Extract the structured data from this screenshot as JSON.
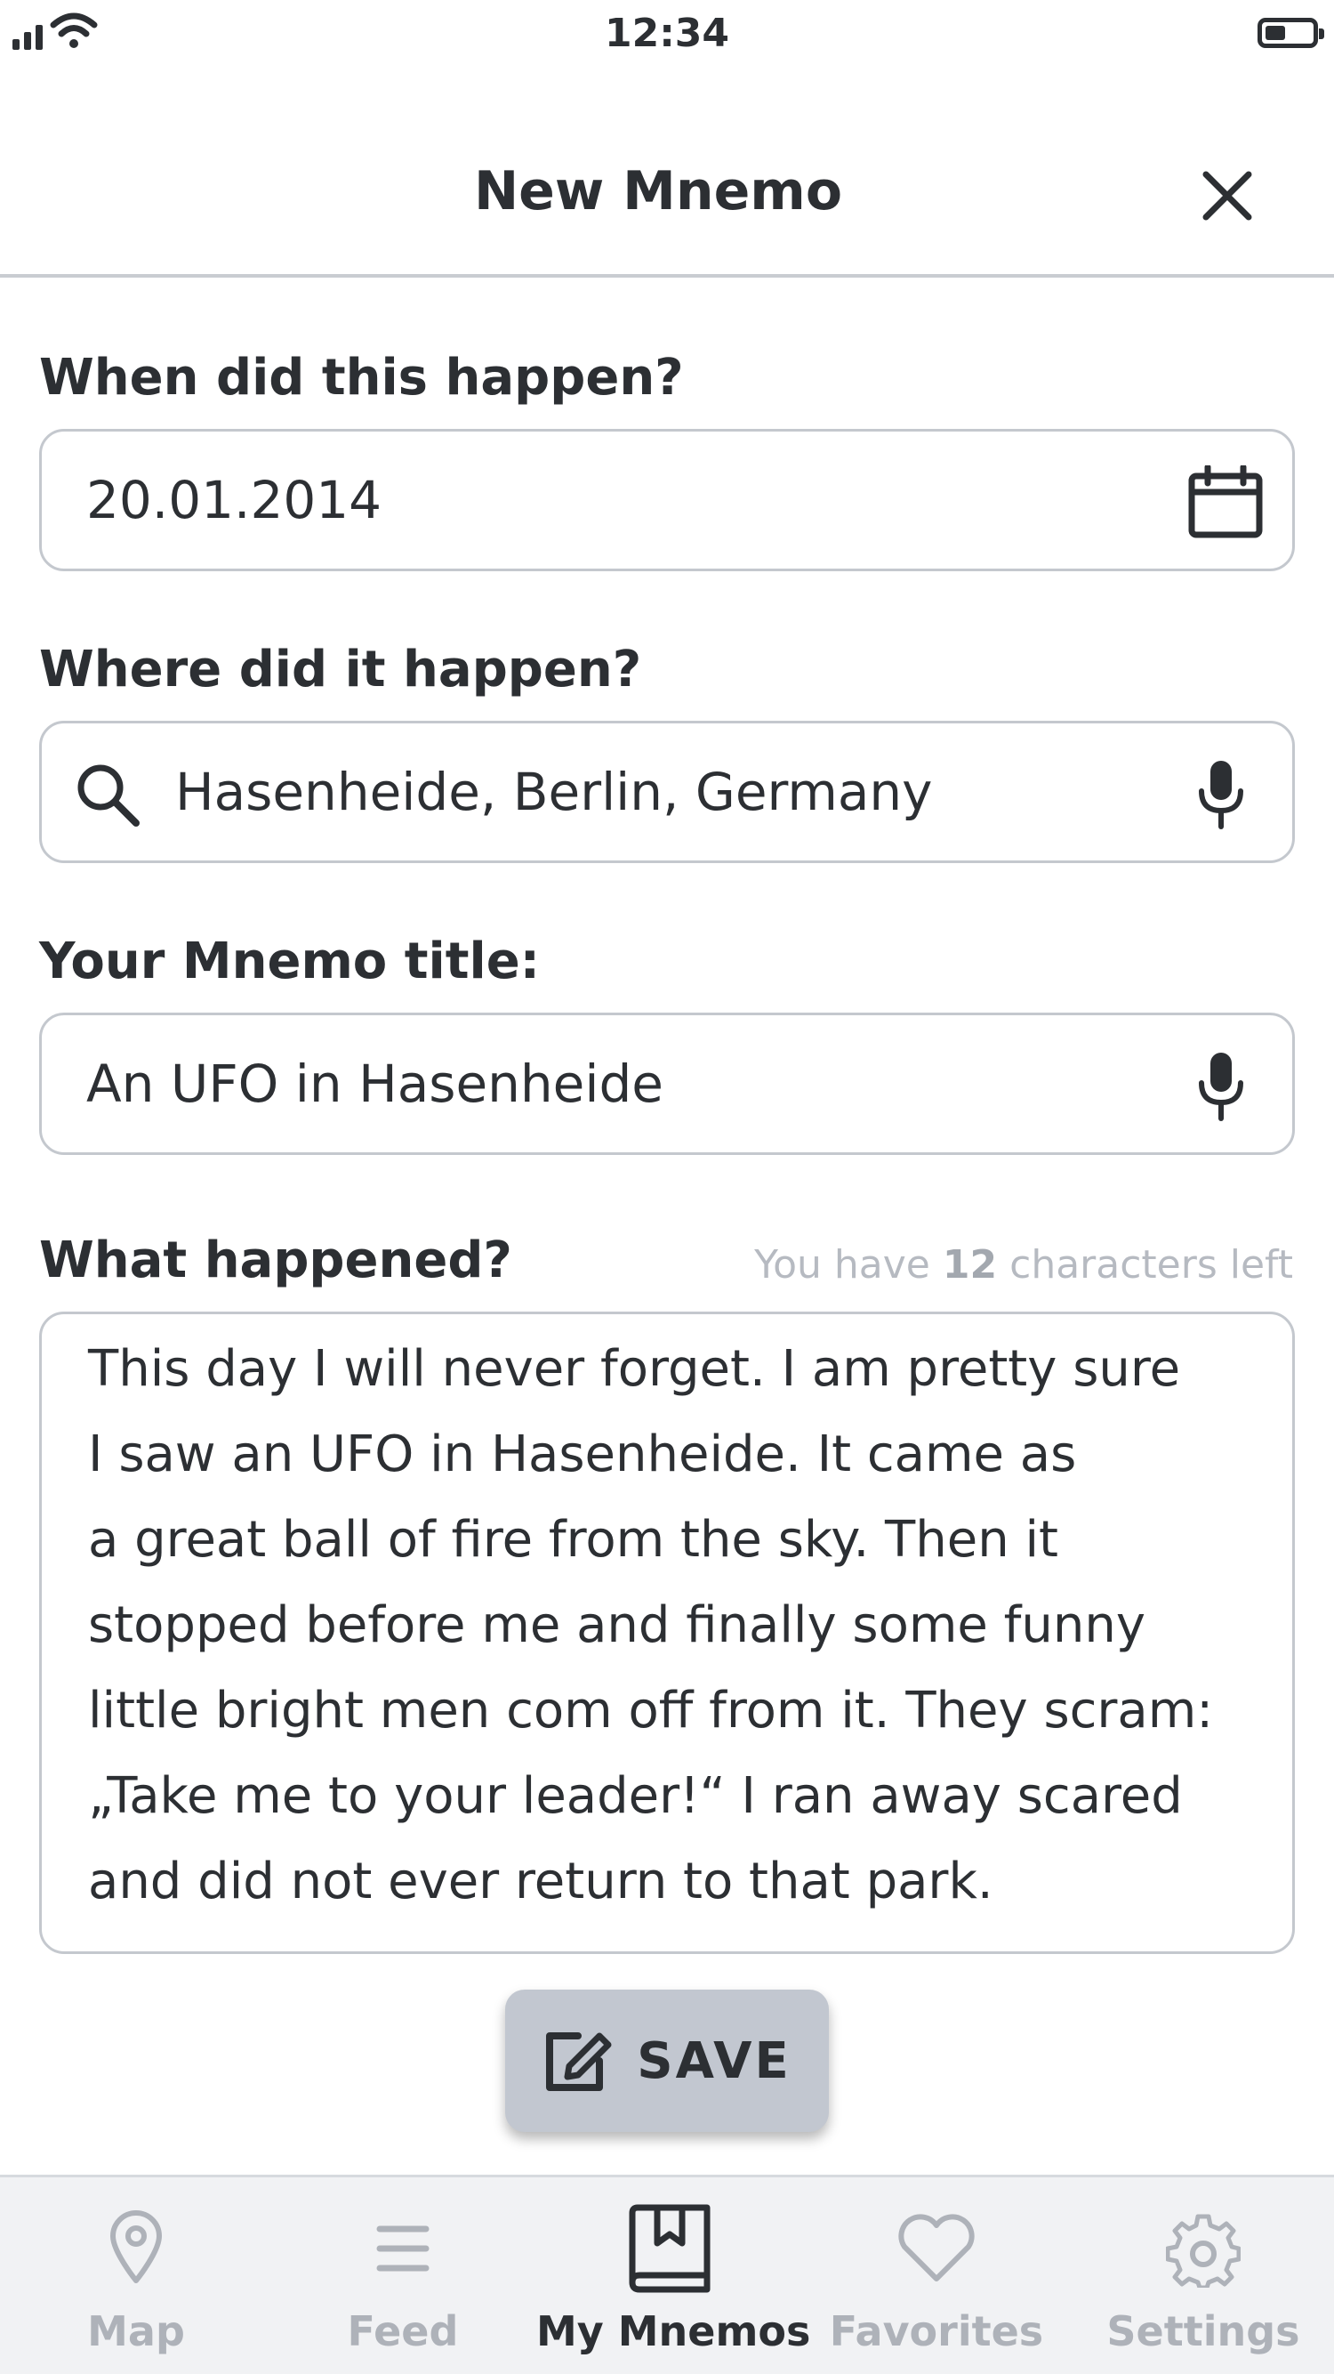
{
  "status_bar": {
    "time": "12:34"
  },
  "header": {
    "title": "New Mnemo"
  },
  "form": {
    "date": {
      "label": "When did this happen?",
      "value": "20.01.2014"
    },
    "location": {
      "label": "Where did it happen?",
      "value": "Hasenheide, Berlin, Germany"
    },
    "title": {
      "label": "Your Mnemo title:",
      "value": "An UFO in Hasenheide"
    },
    "story": {
      "label": "What happened?",
      "chars_left_prefix": "You have",
      "chars_left_count": "12",
      "chars_left_suffix": "characters left",
      "lines": [
        "This day I will never forget. I am pretty sure",
        "I saw an UFO in Hasenheide. It came as",
        "a great ball of fire from the sky. Then it",
        "stopped before me and finally some funny",
        "little bright men com off from it. They scram:",
        "„Take me to your leader!“ I ran away scared",
        "and did not ever return to that park."
      ]
    }
  },
  "save_button": {
    "label": "SAVE"
  },
  "tabbar": {
    "tabs": [
      {
        "label": "Map",
        "icon": "map-pin-icon",
        "active": false
      },
      {
        "label": "Feed",
        "icon": "menu-icon",
        "active": false
      },
      {
        "label": "My Mnemos",
        "icon": "book-icon",
        "active": true
      },
      {
        "label": "Favorites",
        "icon": "heart-icon",
        "active": false
      },
      {
        "label": "Settings",
        "icon": "gear-icon",
        "active": false
      }
    ]
  },
  "colors": {
    "text": "#2c2f33",
    "border": "#c4c8ce",
    "inactive_tab": "#aeb2b9",
    "save_button": "#c2c7d0",
    "tabbar_bg": "#f1f2f4"
  }
}
